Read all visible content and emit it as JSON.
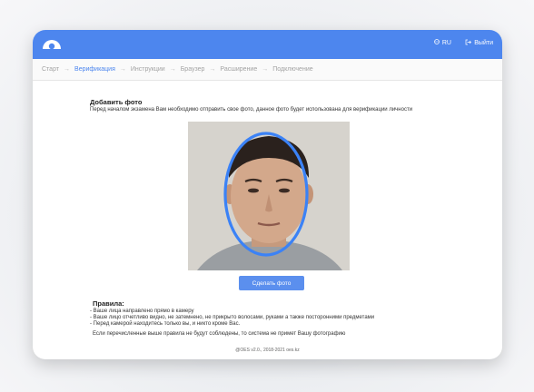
{
  "header": {
    "lang": "RU",
    "logout": "Выйти",
    "brand_color": "#4d86ee"
  },
  "steps": [
    {
      "label": "Старт",
      "active": false
    },
    {
      "label": "Верификация",
      "active": true
    },
    {
      "label": "Инструкции",
      "active": false
    },
    {
      "label": "Браузер",
      "active": false
    },
    {
      "label": "Расширение",
      "active": false
    },
    {
      "label": "Подключение",
      "active": false
    }
  ],
  "main": {
    "title": "Добавить фото",
    "subtitle": "Перед началом экзамена Вам необходимо отправить свое фото, данное фото будет использована для верификации личности",
    "capture_button": "Сделать фото",
    "rules_title": "Правила:",
    "rules": [
      "- Ваше лица направлено прямо в камеру",
      "- Ваше лицо отчетливо видно, не затемнено, не прикрыто волосами, руками а также посторонними предметами",
      "- Перед камерой находитесь только вы, и никто кроме Вас."
    ],
    "warning": "Если перечисленные выше правила не будут соблюдены, то система не примет Вашу фотографию"
  },
  "footer": {
    "text": "@OES v2.0., 2018-2021 oes.kz"
  }
}
